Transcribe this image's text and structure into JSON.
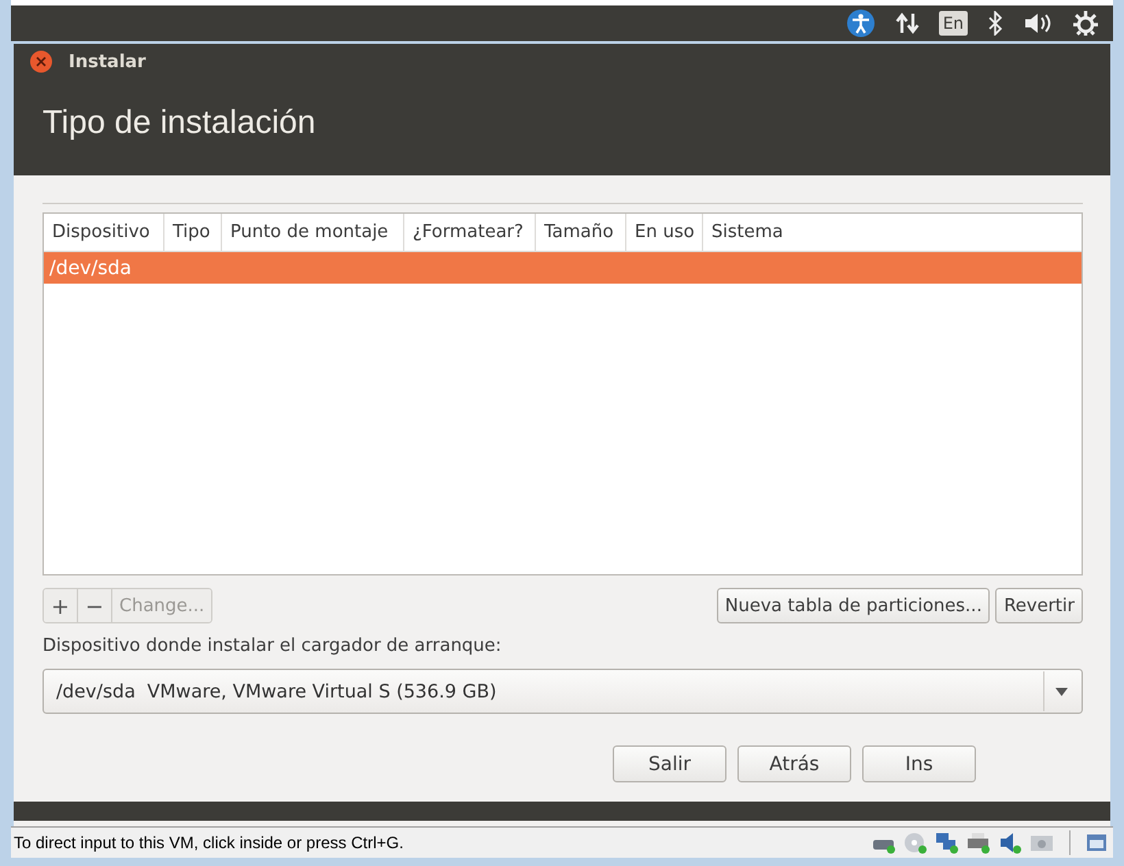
{
  "top_panel": {
    "keyboard_layout": "En"
  },
  "window": {
    "title": "Instalar"
  },
  "header": {
    "title": "Tipo de instalación"
  },
  "table": {
    "columns": [
      "Dispositivo",
      "Tipo",
      "Punto de montaje",
      "¿Formatear?",
      "Tamaño",
      "En uso",
      "Sistema"
    ],
    "rows": [
      {
        "cells": [
          "/dev/sda"
        ],
        "selected": true
      }
    ]
  },
  "partition_tools": [
    {
      "label": "+",
      "disabled": false
    },
    {
      "label": "−",
      "disabled": false
    },
    {
      "label": "Change...",
      "disabled": true
    }
  ],
  "table_buttons": [
    "Nueva tabla de particiones...",
    "Revertir"
  ],
  "bootloader": {
    "label": "Dispositivo donde instalar el cargador de arranque:",
    "value": "/dev/sda  VMware, VMware Virtual S (536.9 GB)"
  },
  "buttons": [
    "Salir",
    "Atrás",
    "Ins"
  ],
  "status_bar": {
    "text": "To direct input to this VM, click inside or press Ctrl+G."
  }
}
